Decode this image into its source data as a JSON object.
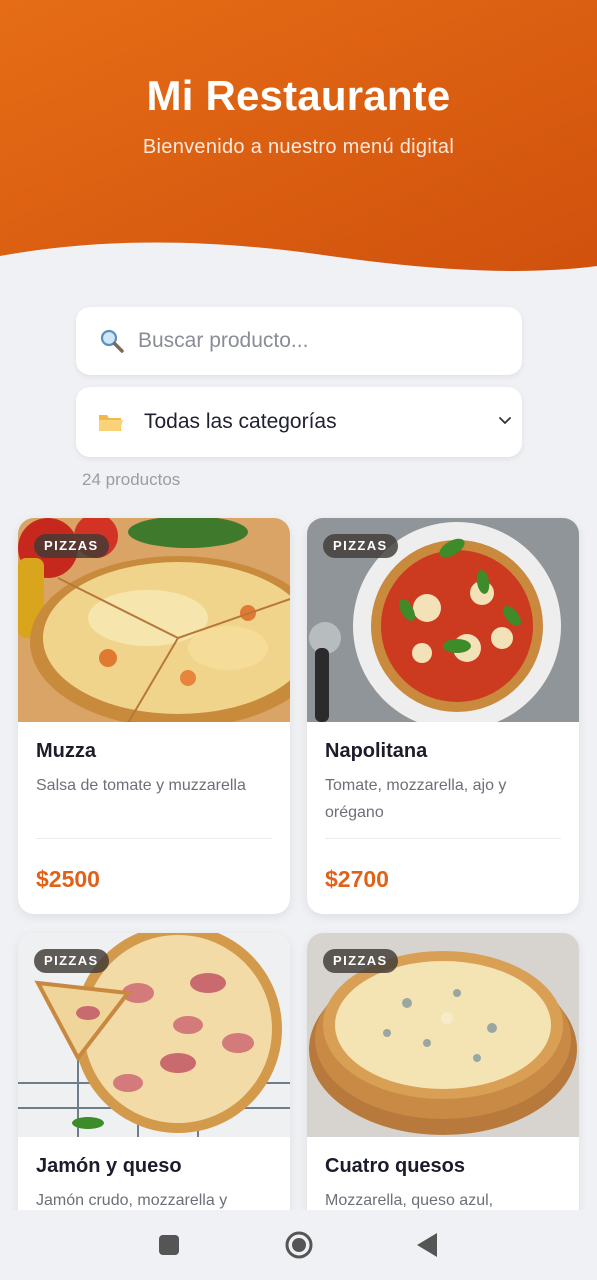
{
  "header": {
    "title": "Mi Restaurante",
    "subtitle": "Bienvenido a nuestro menú digital"
  },
  "search": {
    "placeholder": "Buscar producto...",
    "icon": "search-icon"
  },
  "category_select": {
    "icon": "folder-icon",
    "selected": "Todas las categorías"
  },
  "results": {
    "count_text": "24 productos"
  },
  "products": [
    {
      "category": "PIZZAS",
      "name": "Muzza",
      "description": "Salsa de tomate y muzzarella",
      "price": "$2500"
    },
    {
      "category": "PIZZAS",
      "name": "Napolitana",
      "description": "Tomate, mozzarella, ajo y orégano",
      "price": "$2700"
    },
    {
      "category": "PIZZAS",
      "name": "Jamón y queso",
      "description": "Jamón crudo, mozzarella y",
      "price": ""
    },
    {
      "category": "PIZZAS",
      "name": "Cuatro quesos",
      "description": "Mozzarella, queso azul,",
      "price": ""
    }
  ],
  "colors": {
    "brand": "#e0621a",
    "hero_start": "#e46a17",
    "hero_end": "#cf4f0c",
    "background": "#f0f1f4"
  },
  "system_nav": {
    "recents_icon": "square-icon",
    "home_icon": "circle-home-icon",
    "back_icon": "triangle-back-icon"
  }
}
